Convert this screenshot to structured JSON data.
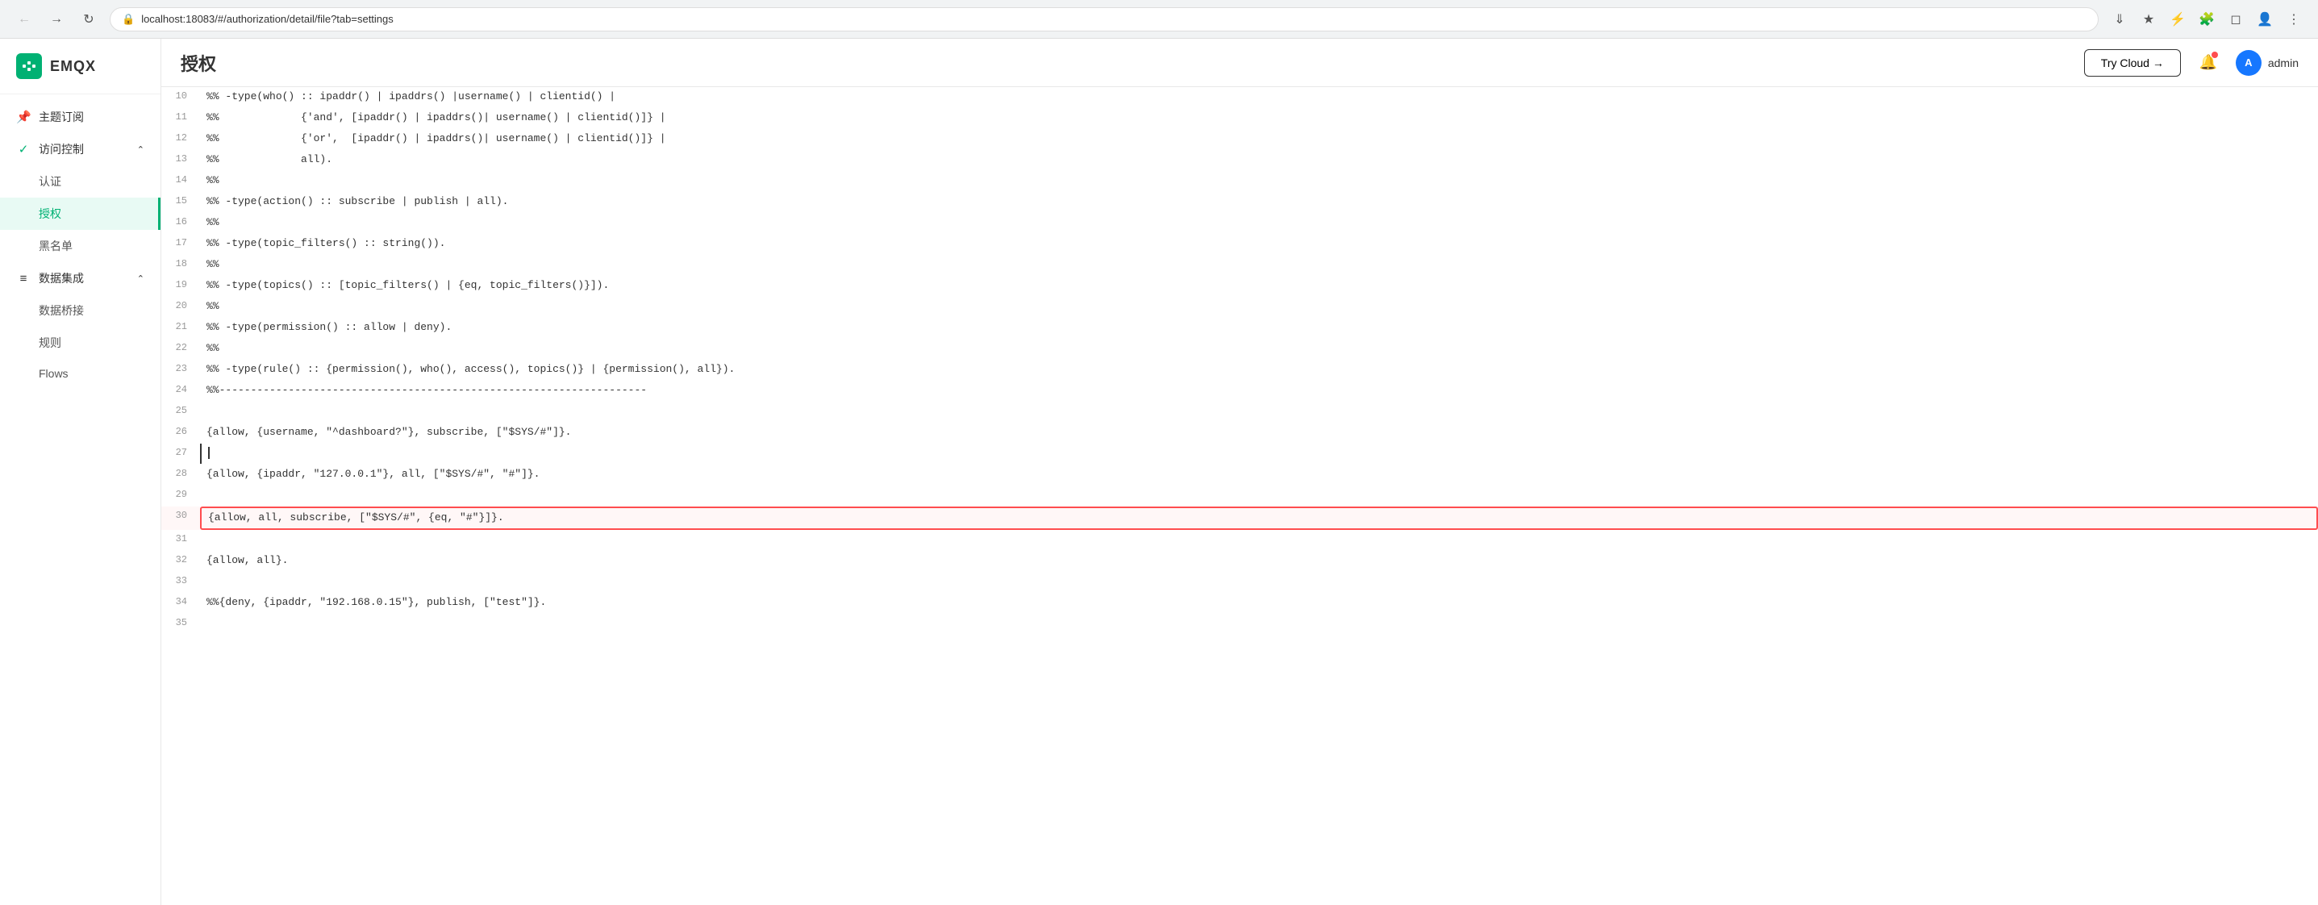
{
  "browser": {
    "back_btn": "←",
    "forward_btn": "→",
    "refresh_btn": "↻",
    "url": "localhost:18083/#/authorization/detail/file?tab=settings",
    "lock_icon": "🔒"
  },
  "sidebar": {
    "logo_text": "EMQX",
    "items": [
      {
        "id": "subscription",
        "label": "主题订阅",
        "icon": "📌",
        "active": false,
        "expandable": false
      },
      {
        "id": "access-control",
        "label": "访问控制",
        "icon": "✓",
        "active": false,
        "expandable": true
      },
      {
        "id": "auth",
        "label": "认证",
        "icon": "",
        "active": false,
        "sub": true
      },
      {
        "id": "authz",
        "label": "授权",
        "icon": "",
        "active": true,
        "sub": true
      },
      {
        "id": "blacklist",
        "label": "黑名单",
        "icon": "",
        "active": false,
        "sub": true
      },
      {
        "id": "data-integration",
        "label": "数据集成",
        "icon": "≡",
        "active": false,
        "expandable": true
      },
      {
        "id": "data-bridge",
        "label": "数据桥接",
        "icon": "",
        "active": false,
        "sub": true
      },
      {
        "id": "rules",
        "label": "规则",
        "icon": "",
        "active": false,
        "sub": true
      },
      {
        "id": "flows",
        "label": "Flows",
        "icon": "",
        "active": false,
        "sub": true
      }
    ]
  },
  "header": {
    "title": "授权",
    "try_cloud_label": "Try Cloud →",
    "notification_icon": "🔔",
    "user_avatar": "A",
    "user_name": "admin"
  },
  "code": {
    "lines": [
      {
        "num": 10,
        "text": "%% -type(who() :: ipaddr() | ipaddrs() |username() | clientid() |",
        "highlight": false,
        "cursor": false
      },
      {
        "num": 11,
        "text": "%%             {'and', [ipaddr() | ipaddrs()| username() | clientid()]} |",
        "highlight": false,
        "cursor": false
      },
      {
        "num": 12,
        "text": "%%             {'or',  [ipaddr() | ipaddrs()| username() | clientid()]} |",
        "highlight": false,
        "cursor": false
      },
      {
        "num": 13,
        "text": "%%             all).",
        "highlight": false,
        "cursor": false
      },
      {
        "num": 14,
        "text": "%%",
        "highlight": false,
        "cursor": false
      },
      {
        "num": 15,
        "text": "%% -type(action() :: subscribe | publish | all).",
        "highlight": false,
        "cursor": false
      },
      {
        "num": 16,
        "text": "%%",
        "highlight": false,
        "cursor": false
      },
      {
        "num": 17,
        "text": "%% -type(topic_filters() :: string()).",
        "highlight": false,
        "cursor": false
      },
      {
        "num": 18,
        "text": "%%",
        "highlight": false,
        "cursor": false
      },
      {
        "num": 19,
        "text": "%% -type(topics() :: [topic_filters() | {eq, topic_filters()}]).",
        "highlight": false,
        "cursor": false
      },
      {
        "num": 20,
        "text": "%%",
        "highlight": false,
        "cursor": false
      },
      {
        "num": 21,
        "text": "%% -type(permission() :: allow | deny).",
        "highlight": false,
        "cursor": false
      },
      {
        "num": 22,
        "text": "%%",
        "highlight": false,
        "cursor": false
      },
      {
        "num": 23,
        "text": "%% -type(rule() :: {permission(), who(), access(), topics()} | {permission(), all}).",
        "highlight": false,
        "cursor": false
      },
      {
        "num": 24,
        "text": "%%--------------------------------------------------------------------",
        "highlight": false,
        "cursor": false
      },
      {
        "num": 25,
        "text": "",
        "highlight": false,
        "cursor": false
      },
      {
        "num": 26,
        "text": "{allow, {username, \"^dashboard?\"}, subscribe, [\"$SYS/#\"]}.",
        "highlight": false,
        "cursor": false
      },
      {
        "num": 27,
        "text": "",
        "highlight": false,
        "cursor": true
      },
      {
        "num": 28,
        "text": "{allow, {ipaddr, \"127.0.0.1\"}, all, [\"$SYS/#\", \"#\"]}.",
        "highlight": false,
        "cursor": false
      },
      {
        "num": 29,
        "text": "",
        "highlight": false,
        "cursor": false
      },
      {
        "num": 30,
        "text": "{allow, all, subscribe, [\"$SYS/#\", {eq, \"#\"}]}.",
        "highlight": true,
        "cursor": false
      },
      {
        "num": 31,
        "text": "",
        "highlight": false,
        "cursor": false
      },
      {
        "num": 32,
        "text": "{allow, all}.",
        "highlight": false,
        "cursor": false
      },
      {
        "num": 33,
        "text": "",
        "highlight": false,
        "cursor": false
      },
      {
        "num": 34,
        "text": "%%{deny, {ipaddr, \"192.168.0.15\"}, publish, [\"test\"]}.",
        "highlight": false,
        "cursor": false
      },
      {
        "num": 35,
        "text": "",
        "highlight": false,
        "cursor": false
      }
    ]
  }
}
